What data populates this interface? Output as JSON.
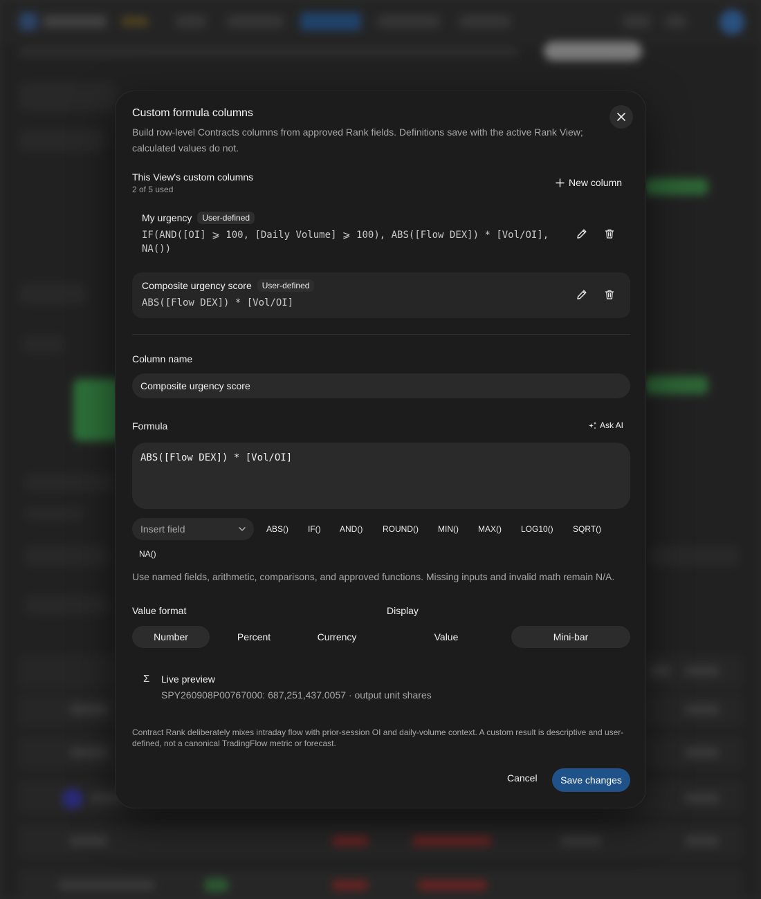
{
  "colors": {
    "accent": "#1f5289",
    "modal_bg": "#1c1c1c",
    "field_bg": "#2a2a2a",
    "muted_text": "#a8a8a8"
  },
  "modal": {
    "title": "Custom formula columns",
    "subtitle": "Build row-level Contracts columns from approved Rank fields. Definitions save with the active Rank View; calculated values do not.",
    "close_icon": "close-icon",
    "section": {
      "title": "This View's custom columns",
      "usage": "2 of 5 used",
      "new_column_label": "New column",
      "new_column_icon": "plus-icon"
    },
    "columns": [
      {
        "name": "My urgency",
        "tag": "User-defined",
        "formula": "IF(AND([OI] ⩾ 100, [Daily Volume] ⩾ 100), ABS([Flow DEX]) * [Vol/OI],\nNA())",
        "edit_icon": "pencil-icon",
        "delete_icon": "trash-icon"
      },
      {
        "name": "Composite urgency score",
        "tag": "User-defined",
        "formula": "ABS([Flow DEX]) * [Vol/OI]",
        "edit_icon": "pencil-icon",
        "delete_icon": "trash-icon"
      }
    ],
    "editor": {
      "column_name_label": "Column name",
      "column_name_value": "Composite urgency score",
      "formula_label": "Formula",
      "ask_ai_label": "Ask AI",
      "ask_ai_icon": "sparkles-icon",
      "formula_value": "ABS([Flow DEX]) * [Vol/OI]",
      "insert_field_placeholder": "Insert field",
      "functions": [
        "ABS()",
        "IF()",
        "AND()",
        "ROUND()",
        "MIN()",
        "MAX()",
        "LOG10()",
        "SQRT()",
        "NA()"
      ],
      "help_text": "Use named fields, arithmetic, comparisons, and approved functions. Missing inputs and invalid math remain N/A.",
      "value_format_label": "Value format",
      "value_format_options": [
        "Number",
        "Percent",
        "Currency"
      ],
      "value_format_selected": "Number",
      "display_label": "Display",
      "display_options": [
        "Value",
        "Mini-bar"
      ],
      "display_selected": "Mini-bar"
    },
    "preview": {
      "icon": "sigma-icon",
      "title": "Live preview",
      "value": "SPY260908P00767000: 687,251,437.0057 · output unit shares"
    },
    "disclaimer": "Contract Rank deliberately mixes intraday flow with prior-session OI and daily-volume context. A custom result is descriptive and user-defined, not a canonical TradingFlow metric or forecast.",
    "cancel_label": "Cancel",
    "save_label": "Save changes"
  }
}
